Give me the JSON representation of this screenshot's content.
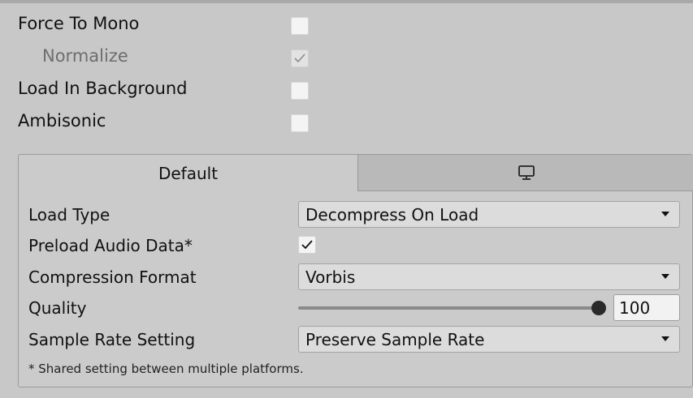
{
  "top_settings": [
    {
      "label": "Force To Mono",
      "checked": false,
      "enabled": true
    },
    {
      "label": "Normalize",
      "checked": true,
      "enabled": false
    },
    {
      "label": "Load In Background",
      "checked": false,
      "enabled": true
    },
    {
      "label": "Ambisonic",
      "checked": false,
      "enabled": true
    }
  ],
  "tabs": {
    "default_label": "Default",
    "standalone_icon": "monitor-icon"
  },
  "platform_settings": {
    "load_type": {
      "label": "Load Type",
      "value": "Decompress On Load"
    },
    "preload_audio_data": {
      "label": "Preload Audio Data*",
      "checked": true
    },
    "compression_format": {
      "label": "Compression Format",
      "value": "Vorbis"
    },
    "quality": {
      "label": "Quality",
      "value": "100",
      "slider_fraction": 1.0
    },
    "sample_rate_setting": {
      "label": "Sample Rate Setting",
      "value": "Preserve Sample Rate"
    }
  },
  "footnote": "* Shared setting between multiple platforms.",
  "colors": {
    "background": "#c8c8c8",
    "tab_inactive": "#b9b9b9",
    "field": "#dcdcdc"
  }
}
